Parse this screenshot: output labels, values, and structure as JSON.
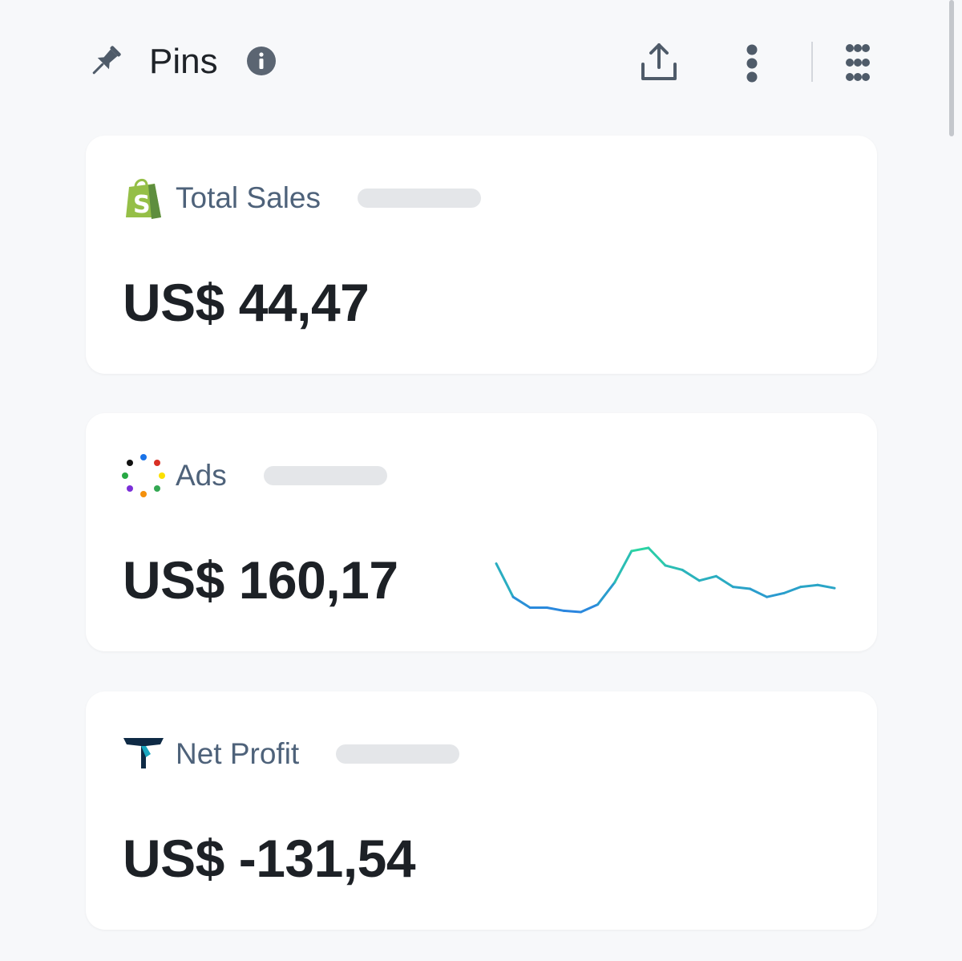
{
  "header": {
    "title": "Pins",
    "pin_icon": "pin-icon",
    "info_icon": "info-icon",
    "share_icon": "share-icon",
    "more_icon": "vertical-dots-icon",
    "grid_icon": "grid-dots-icon"
  },
  "cards": [
    {
      "title": "Total Sales",
      "value": "US$ 44,47",
      "icon": "shopify-icon"
    },
    {
      "title": "Ads",
      "value": "US$ 160,17",
      "icon": "ads-dots-icon"
    },
    {
      "title": "Net Profit",
      "value": "US$ -131,54",
      "icon": "triple-whale-icon"
    }
  ],
  "chart_data": {
    "type": "line",
    "series": [
      {
        "values": [
          0.75,
          0.22,
          0.05,
          0.05,
          0.0,
          -0.02,
          0.1,
          0.45,
          0.95,
          1.0,
          0.72,
          0.65,
          0.48,
          0.55,
          0.38,
          0.35,
          0.22,
          0.28,
          0.38,
          0.41,
          0.36
        ]
      }
    ],
    "colors": [
      "#2bd6a1",
      "#2a84e0"
    ],
    "grid": false,
    "legend": "none"
  }
}
